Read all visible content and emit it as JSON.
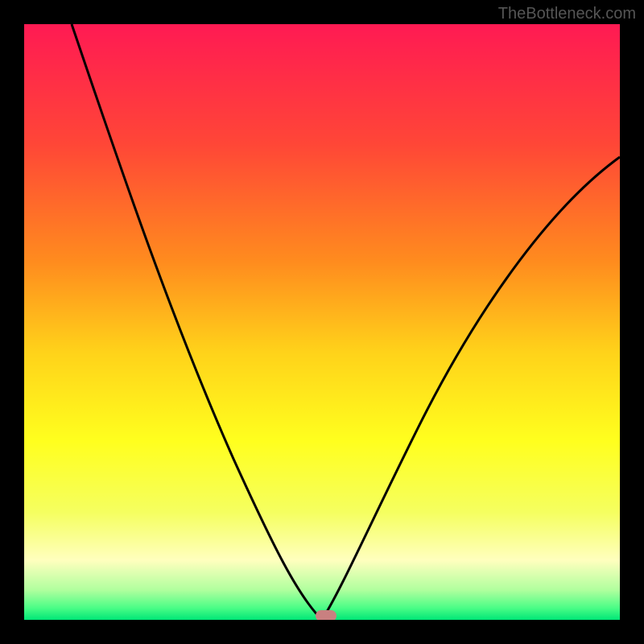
{
  "watermark": "TheBottleneck.com",
  "chart_data": {
    "type": "line",
    "title": "",
    "xlabel": "",
    "ylabel": "",
    "x_range": [
      0,
      100
    ],
    "y_range": [
      0,
      100
    ],
    "minimum_x": 50,
    "series": [
      {
        "name": "bottleneck-curve",
        "description": "V-shaped curve dipping to zero near x≈50, rising steeply toward both sides",
        "x": [
          8,
          12,
          16,
          20,
          24,
          28,
          32,
          36,
          40,
          44,
          48,
          50,
          52,
          56,
          60,
          65,
          70,
          75,
          80,
          85,
          90,
          95,
          100
        ],
        "y": [
          100,
          90,
          80,
          70,
          60,
          51,
          42,
          33,
          25,
          16,
          6,
          0,
          5,
          15,
          24,
          34,
          43,
          51,
          58,
          64,
          69,
          74,
          78
        ]
      }
    ],
    "background_gradient": {
      "stops": [
        {
          "pos": 0.0,
          "color": "#ff1a53"
        },
        {
          "pos": 0.2,
          "color": "#ff4637"
        },
        {
          "pos": 0.4,
          "color": "#ff8c1e"
        },
        {
          "pos": 0.55,
          "color": "#ffd21a"
        },
        {
          "pos": 0.7,
          "color": "#ffff1e"
        },
        {
          "pos": 0.82,
          "color": "#f5ff60"
        },
        {
          "pos": 0.9,
          "color": "#ffffbe"
        },
        {
          "pos": 0.95,
          "color": "#b0ff9e"
        },
        {
          "pos": 0.98,
          "color": "#4bfd86"
        },
        {
          "pos": 1.0,
          "color": "#00e677"
        }
      ]
    },
    "marker": {
      "x": 50,
      "y": 0,
      "color": "#c98080"
    }
  }
}
